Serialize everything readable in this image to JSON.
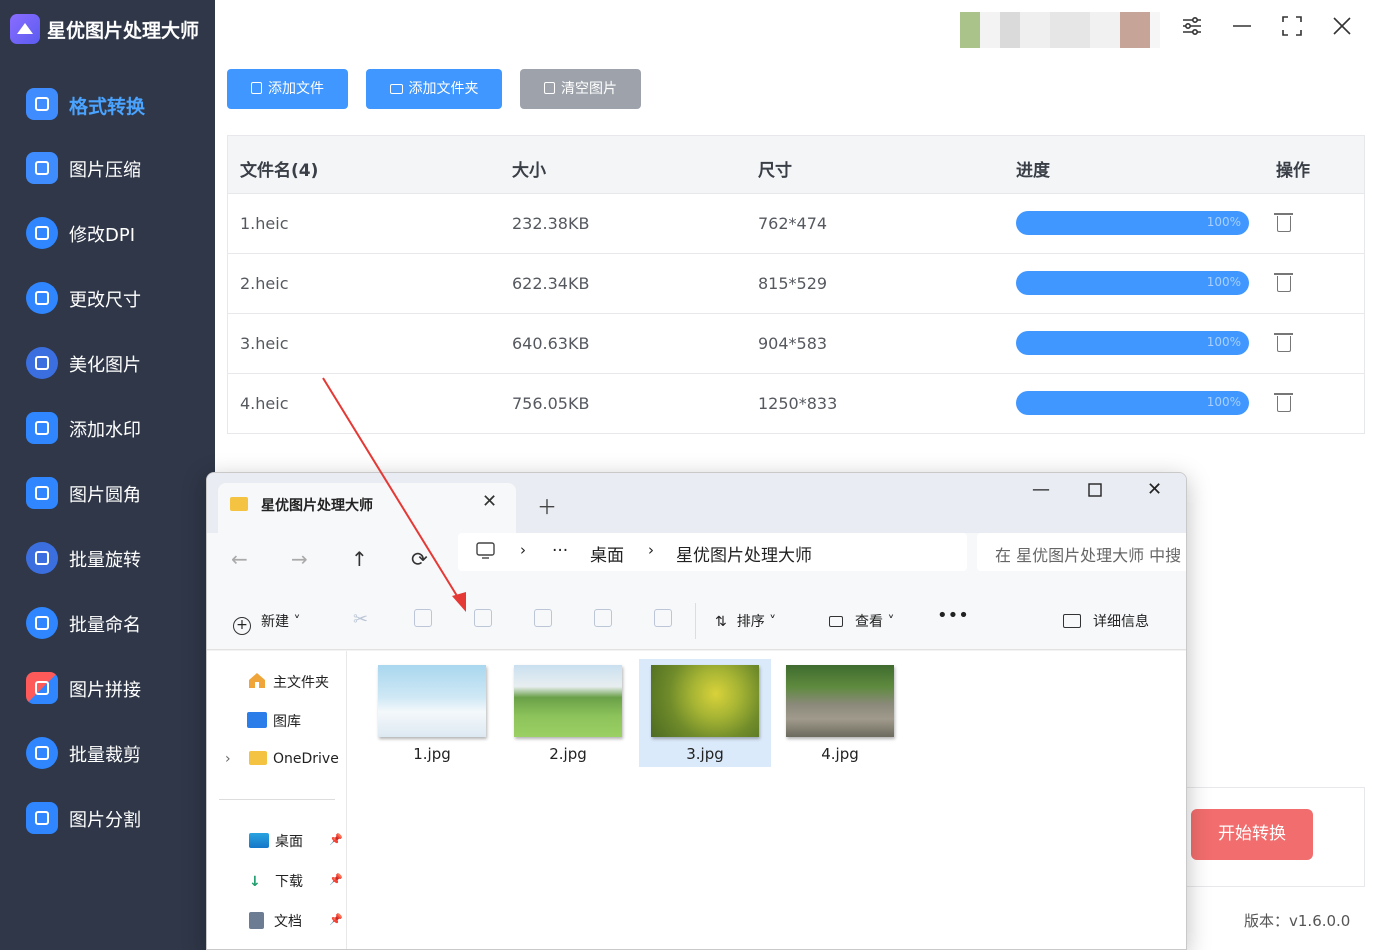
{
  "app": {
    "title": "星优图片处理大师",
    "version": "版本：v1.6.0.0"
  },
  "sidebar": {
    "items": [
      {
        "label": "格式转换",
        "active": true
      },
      {
        "label": "图片压缩"
      },
      {
        "label": "修改DPI"
      },
      {
        "label": "更改尺寸"
      },
      {
        "label": "美化图片"
      },
      {
        "label": "添加水印"
      },
      {
        "label": "图片圆角"
      },
      {
        "label": "批量旋转"
      },
      {
        "label": "批量命名"
      },
      {
        "label": "图片拼接"
      },
      {
        "label": "批量裁剪"
      },
      {
        "label": "图片分割"
      }
    ]
  },
  "toolbar": {
    "add_file": "添加文件",
    "add_folder": "添加文件夹",
    "clear": "清空图片"
  },
  "table": {
    "headers": [
      "文件名(4)",
      "大小",
      "尺寸",
      "进度",
      "操作"
    ],
    "rows": [
      {
        "name": "1.heic",
        "size": "232.38KB",
        "dims": "762*474",
        "progress": "100%"
      },
      {
        "name": "2.heic",
        "size": "622.34KB",
        "dims": "815*529",
        "progress": "100%"
      },
      {
        "name": "3.heic",
        "size": "640.63KB",
        "dims": "904*583",
        "progress": "100%"
      },
      {
        "name": "4.heic",
        "size": "756.05KB",
        "dims": "1250*833",
        "progress": "100%"
      }
    ]
  },
  "start_button": "开始转换",
  "explorer": {
    "tab_title": "星优图片处理大师",
    "breadcrumb": [
      "桌面",
      "星优图片处理大师"
    ],
    "search_placeholder": "在 星优图片处理大师 中搜",
    "commands": {
      "new": "新建",
      "sort": "排序",
      "view": "查看",
      "details": "详细信息"
    },
    "nav": {
      "home": "主文件夹",
      "gallery": "图库",
      "onedrive": "OneDrive",
      "desktop": "桌面",
      "downloads": "下载",
      "documents": "文档"
    },
    "files": [
      "1.jpg",
      "2.jpg",
      "3.jpg",
      "4.jpg"
    ]
  }
}
